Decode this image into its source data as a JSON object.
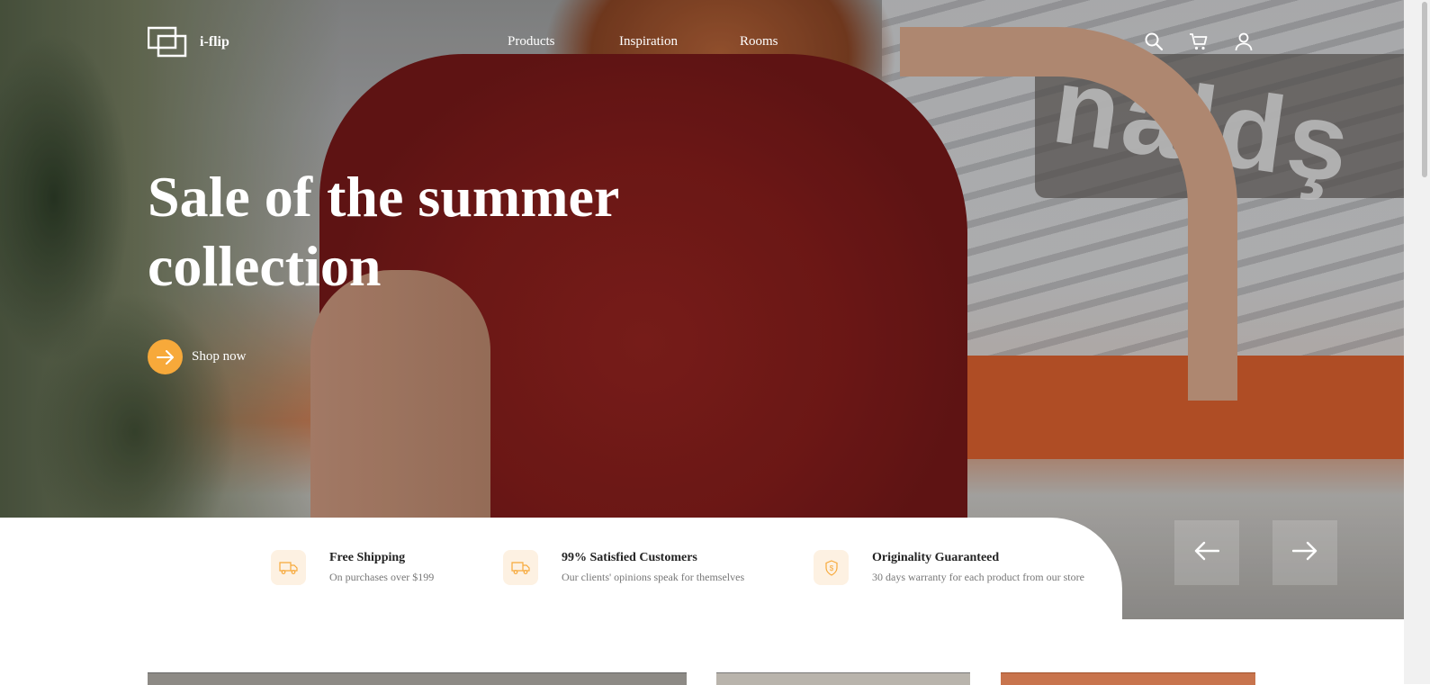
{
  "header": {
    "brand": "i-flip",
    "nav": [
      "Products",
      "Inspiration",
      "Rooms"
    ],
    "icons": [
      "search-icon",
      "cart-icon",
      "user-icon"
    ]
  },
  "hero": {
    "headline": "Sale of the summer collection",
    "cta_label": "Shop now",
    "background_sign_text": "naldş"
  },
  "features": [
    {
      "icon": "truck-icon",
      "title": "Free Shipping",
      "subtitle": "On purchases over $199"
    },
    {
      "icon": "truck-icon",
      "title": "99% Satisfied Customers",
      "subtitle": "Our clients' opinions speak for themselves"
    },
    {
      "icon": "shield-dollar-icon",
      "title": "Originality Guaranteed",
      "subtitle": "30 days warranty for each product from our store"
    }
  ],
  "slider": {
    "prev": "arrow-left-icon",
    "next": "arrow-right-icon"
  },
  "colors": {
    "accent": "#f7a93a",
    "feature_icon_bg": "#fdf1e2",
    "text_dark": "#222222",
    "text_muted": "#777777"
  }
}
